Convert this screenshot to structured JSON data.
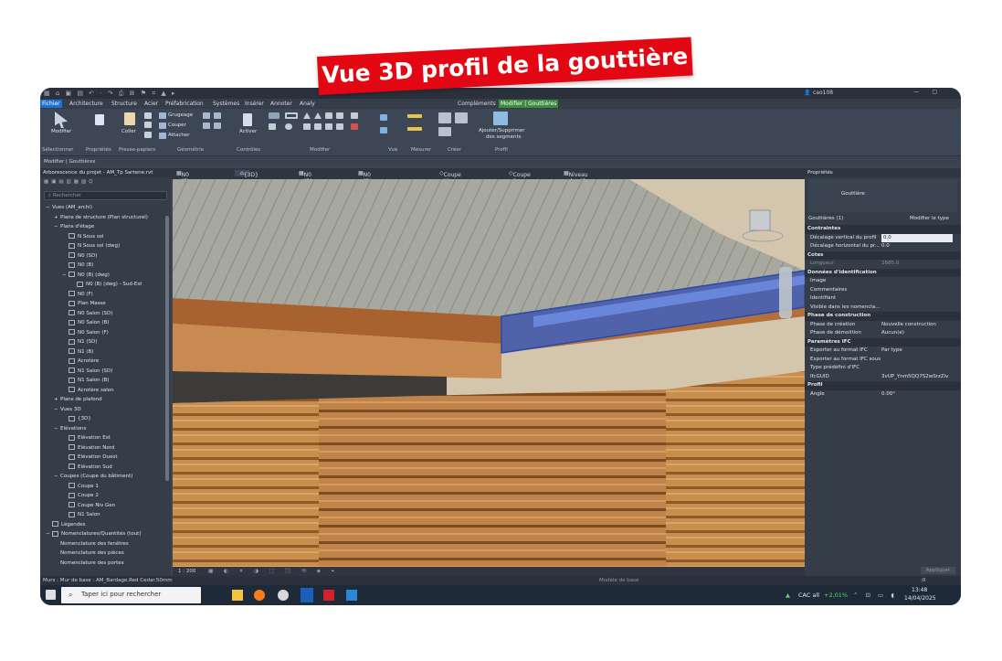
{
  "banner": {
    "text": "Vue 3D profil de la gouttière"
  },
  "titlebar": {
    "user": "cao108",
    "qat_icons": "▦ ⌂ ▣ ▤ ↶ · ↷ ⎙ ⊞ ⚑ ⌗ ▲ ▸"
  },
  "ribbon_tabs": [
    "Fichier",
    "Architecture",
    "Structure",
    "Acier",
    "Préfabrication",
    "Systèmes",
    "Insérer",
    "Annoter",
    "Analy",
    "Compléments",
    "Modifier | Gouttières"
  ],
  "ribbon": {
    "modifier": "Modifier",
    "selectionner": "Sélectionner",
    "proprietes": "Propriétés",
    "coller": "Coller",
    "presse_papiers": "Presse-papiers",
    "grugeage": "Grugeage",
    "couper": "Couper",
    "attacher": "Attacher",
    "geometrie": "Géométrie",
    "activer": "Activer",
    "controles": "Contrôles",
    "modifier_group": "Modifier",
    "vue": "Vue",
    "mesurer": "Mesurer",
    "creer": "Créer",
    "ajouter_supprimer": "Ajouter/Supprimer",
    "des_segments": "des segments",
    "profil": "Profil"
  },
  "context_bar": "Modifier | Gouttières",
  "project_browser": {
    "title": "Arborescence du projet - AM_Tp Sartene.rvt",
    "search_placeholder": "Rechercher",
    "items": [
      {
        "label": "Vues (AM_archi)",
        "level": 0,
        "prefix": "−"
      },
      {
        "label": "Plans de structure (Plan structurel)",
        "level": 1,
        "prefix": "+"
      },
      {
        "label": "Plans d'étage",
        "level": 1,
        "prefix": "−"
      },
      {
        "label": "N Sous sol",
        "level": 2,
        "prefix": ""
      },
      {
        "label": "N Sous sol (dwg)",
        "level": 2,
        "prefix": ""
      },
      {
        "label": "N0 (SD)",
        "level": 2,
        "prefix": ""
      },
      {
        "label": "N0 (B)",
        "level": 2,
        "prefix": ""
      },
      {
        "label": "N0 (B) (dwg)",
        "level": 2,
        "prefix": "−"
      },
      {
        "label": "N0 (B) (dwg) - Sud-Est",
        "level": 3,
        "prefix": ""
      },
      {
        "label": "N0 (F)",
        "level": 2,
        "prefix": ""
      },
      {
        "label": "Plan Masse",
        "level": 2,
        "prefix": ""
      },
      {
        "label": "N0 Salon (SD)",
        "level": 2,
        "prefix": ""
      },
      {
        "label": "N0 Salon (B)",
        "level": 2,
        "prefix": ""
      },
      {
        "label": "N0 Salon (F)",
        "level": 2,
        "prefix": ""
      },
      {
        "label": "N1 (SD)",
        "level": 2,
        "prefix": ""
      },
      {
        "label": "N1 (B)",
        "level": 2,
        "prefix": ""
      },
      {
        "label": "Acrotère",
        "level": 2,
        "prefix": ""
      },
      {
        "label": "N1 Salon (SD)",
        "level": 2,
        "prefix": ""
      },
      {
        "label": "N1 Salon (B)",
        "level": 2,
        "prefix": ""
      },
      {
        "label": "Acrotère salon",
        "level": 2,
        "prefix": ""
      },
      {
        "label": "Plans de plafond",
        "level": 1,
        "prefix": "+"
      },
      {
        "label": "Vues 3D",
        "level": 1,
        "prefix": "−"
      },
      {
        "label": "{3D}",
        "level": 2,
        "prefix": ""
      },
      {
        "label": "Elévations",
        "level": 1,
        "prefix": "−"
      },
      {
        "label": "Elévation Est",
        "level": 2,
        "prefix": ""
      },
      {
        "label": "Elévation Nord",
        "level": 2,
        "prefix": ""
      },
      {
        "label": "Elévation Ouest",
        "level": 2,
        "prefix": ""
      },
      {
        "label": "Elévation Sud",
        "level": 2,
        "prefix": ""
      },
      {
        "label": "Coupes (Coupe du bâtiment)",
        "level": 1,
        "prefix": "−"
      },
      {
        "label": "Coupe 1",
        "level": 2,
        "prefix": ""
      },
      {
        "label": "Coupe 2",
        "level": 2,
        "prefix": ""
      },
      {
        "label": "Coupe Niv Gen",
        "level": 2,
        "prefix": ""
      },
      {
        "label": "N1 Salon",
        "level": 2,
        "prefix": ""
      },
      {
        "label": "Légendes",
        "level": 0,
        "prefix": ""
      },
      {
        "label": "Nomenclatures/Quantités (tout)",
        "level": 0,
        "prefix": "−"
      },
      {
        "label": "Nomenclature des fenêtres",
        "level": 1,
        "prefix": ""
      },
      {
        "label": "Nomenclature des pièces",
        "level": 1,
        "prefix": ""
      },
      {
        "label": "Nomenclature des portes",
        "level": 1,
        "prefix": ""
      }
    ]
  },
  "doc_tabs": [
    "N0 (F)",
    "{3D}",
    "N0 (B) (dwg)",
    "N0 (B) (dwg) - Sud-Est",
    "Coupe Niv Gen",
    "Coupe 2",
    "Niveau de réf."
  ],
  "viewport": {
    "scale": "1 : 200"
  },
  "properties": {
    "title": "Propriétés",
    "type_name": "Gouttière",
    "filter": "Gouttières (1)",
    "edit_type": "Modifier le type",
    "sections": [
      {
        "name": "Contraintes",
        "rows": [
          [
            "Décalage vertical du profil",
            "0.0"
          ],
          [
            "Décalage horizontal du pr...",
            "0.0"
          ]
        ]
      },
      {
        "name": "Cotes",
        "rows": [
          [
            "Longueur",
            "2685.0"
          ]
        ]
      },
      {
        "name": "Données d'identification",
        "rows": [
          [
            "Image",
            ""
          ],
          [
            "Commentaires",
            ""
          ],
          [
            "Identifiant",
            ""
          ],
          [
            "Visible dans les nomencla...",
            ""
          ]
        ]
      },
      {
        "name": "Phase de construction",
        "rows": [
          [
            "Phase de création",
            "Nouvelle construction"
          ],
          [
            "Phase de démolition",
            "Aucun(e)"
          ]
        ]
      },
      {
        "name": "Paramètres IFC",
        "rows": [
          [
            "Exporter au format IFC",
            "Par type"
          ],
          [
            "Exporter au format IFC sous",
            ""
          ],
          [
            "Type prédéfini d'IFC",
            ""
          ],
          [
            "IfcGUID",
            "3vUP_Ynm5QQ7S2wSrzZiv"
          ]
        ]
      },
      {
        "name": "Profil",
        "rows": [
          [
            "Angle",
            "0.00°"
          ]
        ]
      }
    ],
    "apply": "Appliquer"
  },
  "status": {
    "text": "Murs : Mur de base : AM_Bardage.Red Cedar.50mm",
    "model": "Modèle de base",
    "coords": ":0"
  },
  "taskbar": {
    "search_placeholder": "Taper ici pour rechercher",
    "ticker": "CAC all",
    "ticker_change": "+2,01%",
    "time": "13:48",
    "date": "14/04/2025"
  }
}
